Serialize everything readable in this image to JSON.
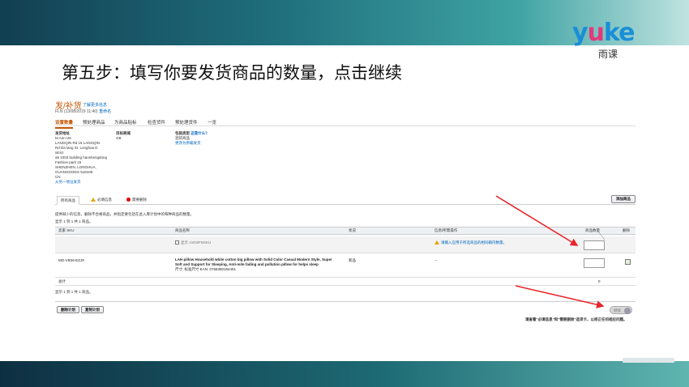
{
  "slide": {
    "title": "第五步：填写你要发货商品的数量，点击继续",
    "logo_y": "y",
    "logo_u": "u",
    "logo_ke": "ke",
    "logo_sub": "雨课"
  },
  "page": {
    "title": "发/补货",
    "learn_more": "了解更多信息",
    "subtitle": "FLN (13/08/2019 11:40)",
    "rename_link": "重命名",
    "steps": [
      "设置数量",
      "预处理商品",
      "为商品贴标",
      "检查货件",
      "预处理货件",
      "一览"
    ],
    "ship_from_label": "发货地址",
    "ship_from_lines": [
      "M Ann UK",
      "LANGQIN Rd 15 LANGQIN",
      "Rd Da lang St. Longhua D",
      "istrict",
      "a5 1003 building haoshengdong",
      "Fashion park 15",
      "SHENZHEN, LONGHUA,",
      "GUANGDONG 518109",
      "CN"
    ],
    "ship_from_link": "从另一地址发货",
    "destination_label": "目标商城",
    "destination_value": "GB",
    "packing_label": "包装类型",
    "packing_link": "这是什么？",
    "packing_value": "混装商品",
    "packing_change": "更改为原箱发货"
  },
  "tabs": {
    "all": "所有商品",
    "fix": "必填信息",
    "remove": "需要删除"
  },
  "add_products_button": "添加商品",
  "hint": "提供缺少的信息，删除不合格商品，并指定要包括在此入库计划中的每种商品的数量。",
  "showing_top": "显示 1 到 1 共 1 商品。",
  "showing_bottom": "显示 1 到 1 共 1 商品。",
  "table": {
    "headers": {
      "sku": "卖家 SKU",
      "name": "商品名称",
      "status": "状况",
      "info": "信息/所需操作",
      "qty": "商品数量",
      "remove": "删除"
    },
    "summary_row": {
      "fnsku": "显示 ASIN/FNSKU",
      "info": "请输入应用于所选商品的相同箱内数量。"
    },
    "item_row": {
      "sku": "MO-V9S6-EZJ9",
      "name_line1": "LAH pillow Household white cotton big pillow with Solid Color Casual Modern Style, Super",
      "name_line2": "Soft and Support for Sleeping, Anti-mite fading and pollution pillow for helps sleep",
      "size": "尺寸: 标准尺寸 EAN: 0768380184451",
      "status": "新品",
      "info": "--"
    },
    "total_label": "总计",
    "total_value": "0"
  },
  "buttons": {
    "delete_plan": "删除计划",
    "copy_plan": "复制计划",
    "continue": "继续"
  },
  "footer_note": "请查看\"必填信息\"和\"需要删除\"选项卡，以修正任何相应问题。",
  "colors": {
    "accent": "#c45500",
    "link": "#0066c0",
    "arrow": "#e8262b"
  }
}
